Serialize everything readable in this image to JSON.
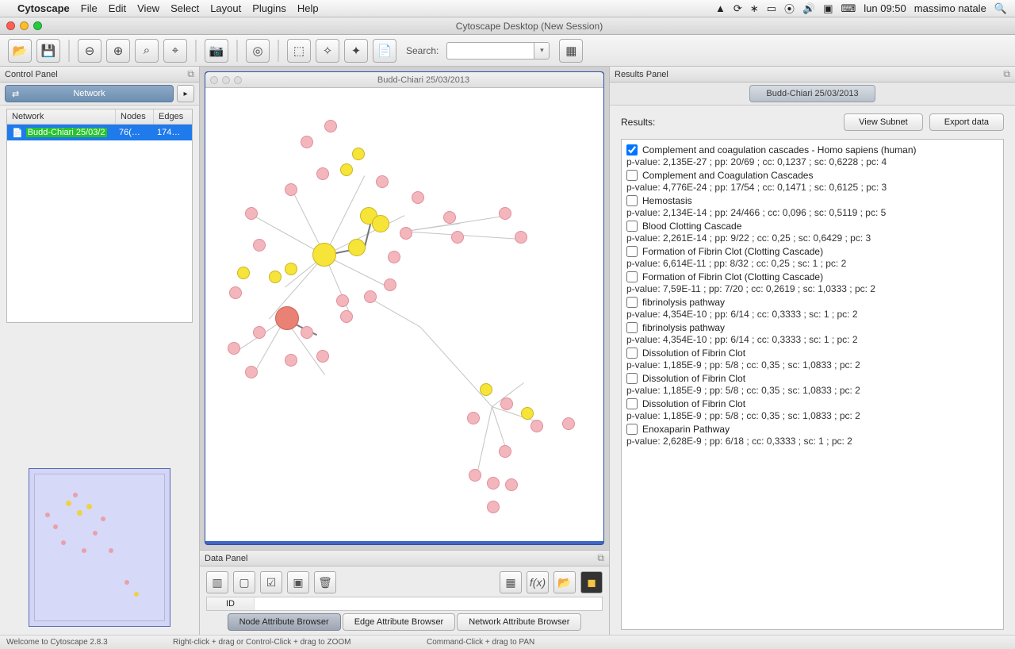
{
  "menubar": {
    "app": "Cytoscape",
    "items": [
      "File",
      "Edit",
      "View",
      "Select",
      "Layout",
      "Plugins",
      "Help"
    ],
    "clock": "lun 09:50",
    "user": "massimo natale"
  },
  "window": {
    "title": "Cytoscape Desktop (New Session)"
  },
  "toolbar": {
    "search_label": "Search:",
    "search_placeholder": ""
  },
  "control": {
    "title": "Control Panel",
    "tab": "Network",
    "columns": {
      "net": "Network",
      "nodes": "Nodes",
      "edges": "Edges"
    },
    "row": {
      "name_pre": "Budd-Chiari 25/03/2",
      "nodes": "76(…",
      "edges": "174…"
    }
  },
  "netwin": {
    "title": "Budd-Chiari 25/03/2013"
  },
  "results": {
    "title": "Results Panel",
    "tab": "Budd-Chiari 25/03/2013",
    "label": "Results:",
    "view": "View Subnet",
    "export": "Export data",
    "items": [
      {
        "checked": true,
        "name": "Complement and coagulation cascades - Homo sapiens (human)",
        "stats": "p-value: 2,135E-27 ; pp: 20/69 ; cc: 0,1237 ; sc: 0,6228 ; pc: 4"
      },
      {
        "checked": false,
        "name": "Complement and Coagulation Cascades",
        "stats": "p-value: 4,776E-24 ; pp: 17/54 ; cc: 0,1471 ; sc: 0,6125 ; pc: 3"
      },
      {
        "checked": false,
        "name": "Hemostasis",
        "stats": "p-value: 2,134E-14 ; pp: 24/466 ; cc: 0,096 ; sc: 0,5119 ; pc: 5"
      },
      {
        "checked": false,
        "name": "Blood Clotting Cascade",
        "stats": "p-value: 2,261E-14 ; pp: 9/22 ; cc: 0,25 ; sc: 0,6429 ; pc: 3"
      },
      {
        "checked": false,
        "name": "Formation of Fibrin Clot (Clotting Cascade)",
        "stats": "p-value: 6,614E-11 ; pp: 8/32 ; cc: 0,25 ; sc: 1 ; pc: 2"
      },
      {
        "checked": false,
        "name": "Formation of Fibrin Clot (Clotting Cascade)",
        "stats": "p-value: 7,59E-11 ; pp: 7/20 ; cc: 0,2619 ; sc: 1,0333 ; pc: 2"
      },
      {
        "checked": false,
        "name": "fibrinolysis pathway",
        "stats": "p-value: 4,354E-10 ; pp: 6/14 ; cc: 0,3333 ; sc: 1 ; pc: 2"
      },
      {
        "checked": false,
        "name": "fibrinolysis pathway",
        "stats": "p-value: 4,354E-10 ; pp: 6/14 ; cc: 0,3333 ; sc: 1 ; pc: 2"
      },
      {
        "checked": false,
        "name": "Dissolution of Fibrin Clot",
        "stats": "p-value: 1,185E-9 ; pp: 5/8 ; cc: 0,35 ; sc: 1,0833 ; pc: 2"
      },
      {
        "checked": false,
        "name": "Dissolution of Fibrin Clot",
        "stats": "p-value: 1,185E-9 ; pp: 5/8 ; cc: 0,35 ; sc: 1,0833 ; pc: 2"
      },
      {
        "checked": false,
        "name": "Dissolution of Fibrin Clot",
        "stats": "p-value: 1,185E-9 ; pp: 5/8 ; cc: 0,35 ; sc: 1,0833 ; pc: 2"
      },
      {
        "checked": false,
        "name": "Enoxaparin Pathway",
        "stats": "p-value: 2,628E-9 ; pp: 6/18 ; cc: 0,3333 ; sc: 1 ; pc: 2"
      }
    ]
  },
  "datapanel": {
    "title": "Data Panel",
    "col": "ID",
    "tabs": [
      "Node Attribute Browser",
      "Edge Attribute Browser",
      "Network Attribute Browser"
    ]
  },
  "status": {
    "welcome": "Welcome to Cytoscape 2.8.3",
    "hint1": "Right-click + drag or Control-Click + drag to ZOOM",
    "hint2": "Command-Click + drag to PAN"
  }
}
